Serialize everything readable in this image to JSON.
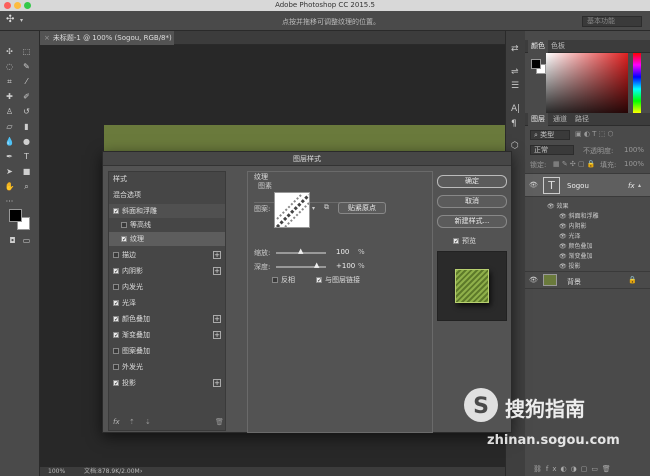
{
  "window": {
    "title": "Adobe Photoshop CC 2015.5"
  },
  "options_bar": {
    "hint": "点按并拖移可调整纹理的位置。",
    "workspace": "基本功能"
  },
  "document": {
    "tab": "未标题-1 @ 100% (Sogou, RGB/8*) *"
  },
  "status": {
    "zoom": "100%",
    "doc_size": "文档:878.9K/2.00M"
  },
  "color_panel": {
    "tabs": [
      "颜色",
      "色板"
    ]
  },
  "layers_panel": {
    "tabs": [
      "图层",
      "通道",
      "路径"
    ],
    "search_placeholder": "类型",
    "blend_mode": "正常",
    "opacity_label": "不透明度:",
    "opacity": "100%",
    "lock_label": "锁定:",
    "fill_label": "填充:",
    "fill": "100%",
    "text_layer": {
      "name": "Sogou",
      "fx": "fx"
    },
    "effects_label": "效果",
    "effects": [
      "斜面和浮雕",
      "内阴影",
      "光泽",
      "颜色叠加",
      "渐变叠加",
      "投影"
    ],
    "bg_layer": "背景"
  },
  "dialog": {
    "title": "图层样式",
    "list_header": "样式",
    "blend_options": "混合选项",
    "items": [
      {
        "label": "斜面和浮雕",
        "checked": true,
        "plus": false
      },
      {
        "label": "等高线",
        "checked": false,
        "plus": false
      },
      {
        "label": "纹理",
        "checked": true,
        "plus": false
      },
      {
        "label": "描边",
        "checked": false,
        "plus": true
      },
      {
        "label": "内阴影",
        "checked": true,
        "plus": true
      },
      {
        "label": "内发光",
        "checked": false,
        "plus": false
      },
      {
        "label": "光泽",
        "checked": true,
        "plus": false
      },
      {
        "label": "颜色叠加",
        "checked": true,
        "plus": true
      },
      {
        "label": "渐变叠加",
        "checked": true,
        "plus": true
      },
      {
        "label": "图案叠加",
        "checked": false,
        "plus": false
      },
      {
        "label": "外发光",
        "checked": false,
        "plus": false
      },
      {
        "label": "投影",
        "checked": true,
        "plus": true
      }
    ],
    "section_title": "纹理",
    "section_sub": "图素",
    "pattern_label": "图案:",
    "snap_button": "贴紧原点",
    "scale_label": "缩放:",
    "scale_value": "100",
    "depth_label": "深度:",
    "depth_value": "+100",
    "percent": "%",
    "invert_label": "反相",
    "link_label": "与图层链接",
    "ok": "确定",
    "cancel": "取消",
    "new_style": "新建样式...",
    "preview_label": "预览",
    "fx_label": "fx"
  },
  "watermark": {
    "brand": "搜狗指南",
    "url": "zhinan.sogou.com"
  },
  "colors": {
    "accent_blue": "#1473e6",
    "artwork_green": "#6a7a3c"
  }
}
